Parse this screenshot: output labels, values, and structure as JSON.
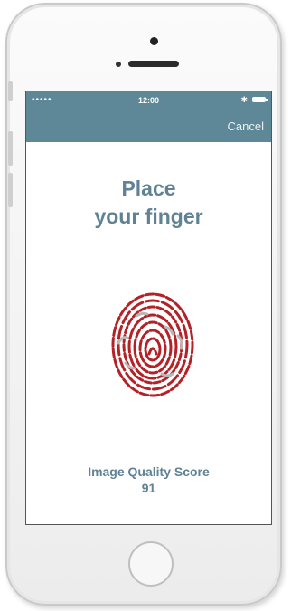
{
  "status_bar": {
    "signal": "•••••",
    "time": "12:00",
    "bluetooth": "✱"
  },
  "nav": {
    "cancel_label": "Cancel"
  },
  "prompt": {
    "line1": "Place",
    "line2": "your finger"
  },
  "quality": {
    "label": "Image Quality Score",
    "value": "91"
  },
  "colors": {
    "header": "#5e8797",
    "text": "#5f8294",
    "fingerprint_ridge": "#b32226",
    "fingerprint_gap": "#b8b8b8"
  },
  "icons": [
    "bluetooth-icon",
    "battery-icon",
    "fingerprint-icon"
  ]
}
